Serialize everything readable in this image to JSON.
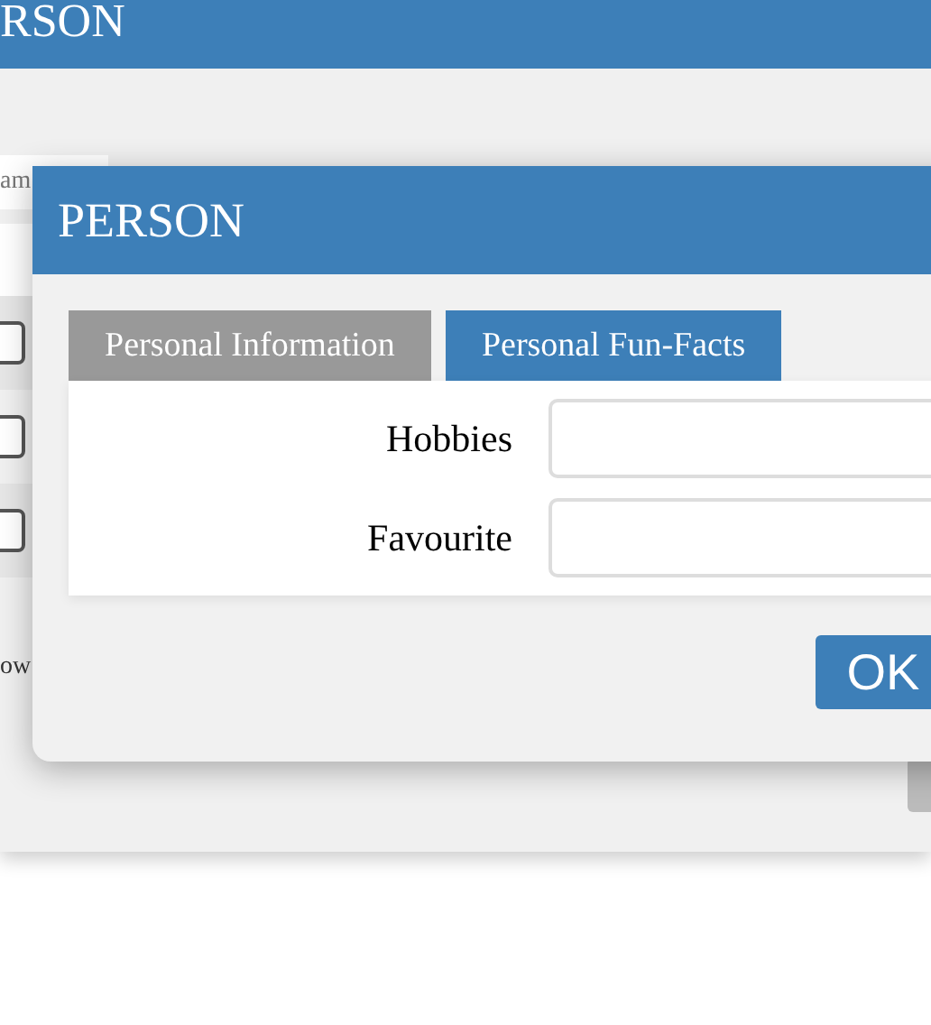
{
  "background_window": {
    "title": "RSON",
    "search": {
      "placeholder": "am"
    },
    "rows": [
      {
        "checked": false
      },
      {
        "checked": false
      },
      {
        "checked": false
      }
    ],
    "footer_text": "ow"
  },
  "dialog": {
    "title": "PERSON",
    "tabs": [
      {
        "label": "Personal Information",
        "selected": false
      },
      {
        "label": "Personal Fun-Facts",
        "selected": true
      }
    ],
    "fields": [
      {
        "label": "Hobbies"
      },
      {
        "label": "Favourite"
      }
    ],
    "buttons": [
      "OK"
    ]
  }
}
